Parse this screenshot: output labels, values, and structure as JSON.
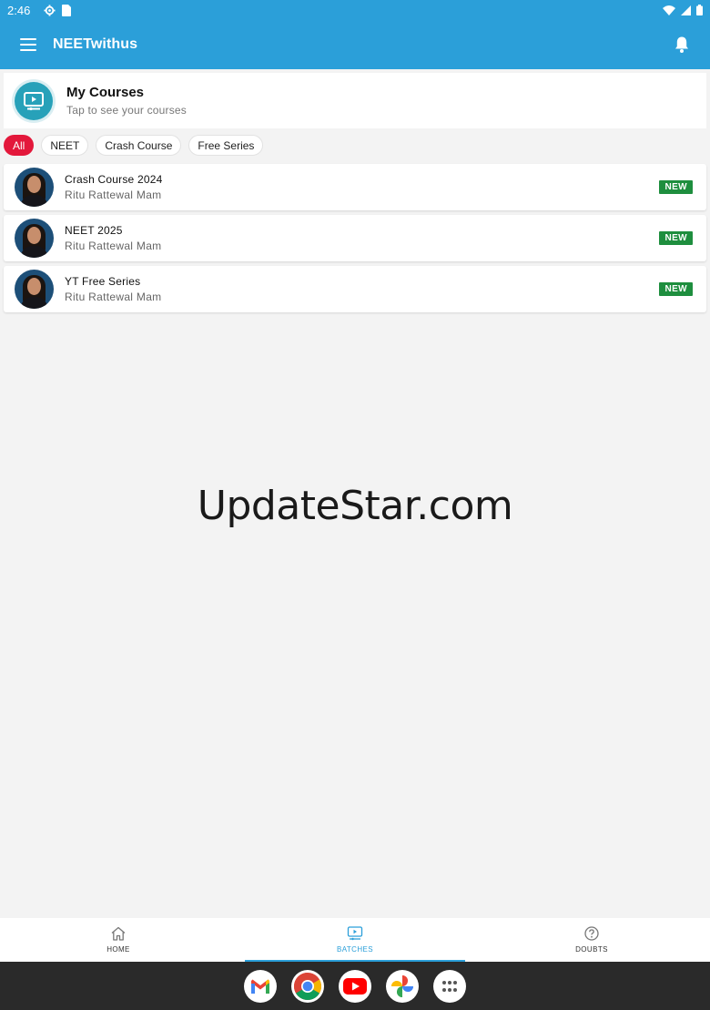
{
  "status_bar": {
    "time": "2:46"
  },
  "app_bar": {
    "title": "NEETwithus"
  },
  "my_courses": {
    "title": "My Courses",
    "subtitle": "Tap to see your courses"
  },
  "filters": [
    "All",
    "NEET",
    "Crash Course",
    "Free Series"
  ],
  "active_filter": "All",
  "courses": [
    {
      "name": "Crash Course 2024",
      "teacher": "Ritu Rattewal Mam",
      "badge": "NEW"
    },
    {
      "name": "NEET 2025",
      "teacher": "Ritu Rattewal Mam",
      "badge": "NEW"
    },
    {
      "name": "YT Free Series",
      "teacher": "Ritu Rattewal Mam",
      "badge": "NEW"
    }
  ],
  "watermark": "UpdateStar.com",
  "bottom_nav": [
    {
      "label": "HOME",
      "icon": "home-icon"
    },
    {
      "label": "BATCHES",
      "icon": "batches-icon"
    },
    {
      "label": "DOUBTS",
      "icon": "help-icon"
    }
  ],
  "active_tab": "BATCHES",
  "dock": [
    "gmail-icon",
    "chrome-icon",
    "youtube-icon",
    "photos-icon",
    "app-drawer-icon"
  ],
  "colors": {
    "primary": "#2b9fd9",
    "chip_active": "#e3183b",
    "badge_green": "#1e8e3e",
    "course_icon": "#27a1b9"
  }
}
